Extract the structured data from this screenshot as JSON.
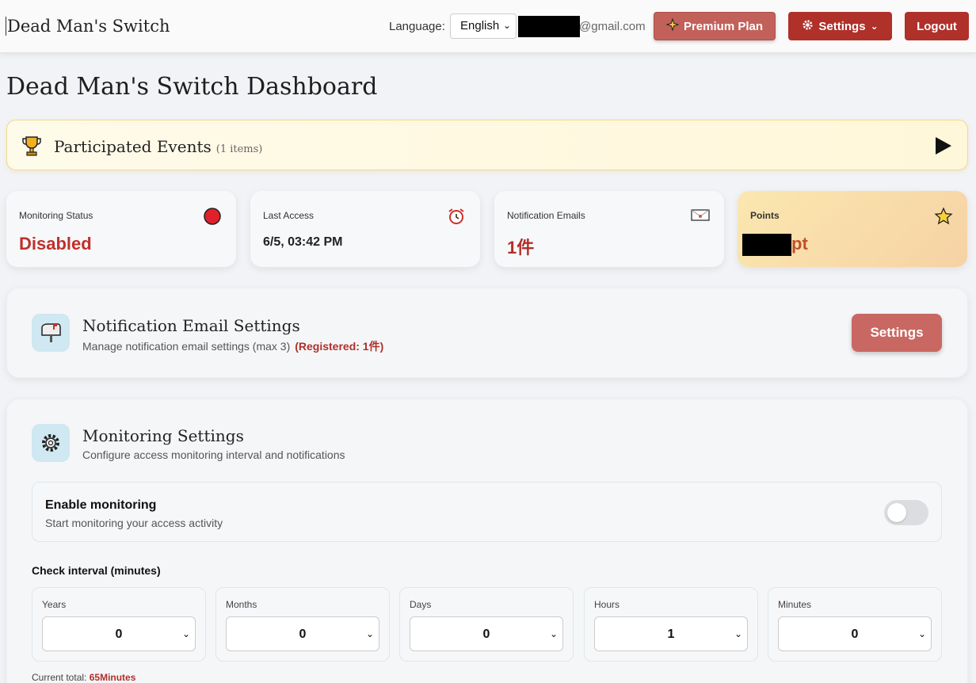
{
  "header": {
    "brand": "Dead Man's Switch",
    "language_label": "Language:",
    "language_value": "English",
    "email_suffix": "@gmail.com",
    "premium_label": "Premium Plan",
    "settings_label": "Settings",
    "logout_label": "Logout"
  },
  "page_title": "Dead Man's Switch Dashboard",
  "events": {
    "title": "Participated Events",
    "count": "(1 items)"
  },
  "stats": {
    "monitoring": {
      "label": "Monitoring Status",
      "value": "Disabled",
      "color": "#c0302a"
    },
    "last_access": {
      "label": "Last Access",
      "value": "6/5, 03:42 PM"
    },
    "emails": {
      "label": "Notification Emails",
      "value": "1件",
      "color": "#b0302a"
    },
    "points": {
      "label": "Points",
      "suffix": "pt",
      "color": "#c0502a"
    }
  },
  "notification_panel": {
    "title": "Notification Email Settings",
    "subtitle": "Manage notification email settings (max 3)",
    "registered": "(Registered: 1件)",
    "button_label": "Settings"
  },
  "monitoring_panel": {
    "title": "Monitoring Settings",
    "subtitle": "Configure access monitoring interval and notifications",
    "enable_title": "Enable monitoring",
    "enable_sub": "Start monitoring your access activity",
    "enabled": false,
    "interval_label": "Check interval (minutes)",
    "fields": [
      {
        "label": "Years",
        "value": "0"
      },
      {
        "label": "Months",
        "value": "0"
      },
      {
        "label": "Days",
        "value": "0"
      },
      {
        "label": "Hours",
        "value": "1"
      },
      {
        "label": "Minutes",
        "value": "0"
      }
    ],
    "total_label": "Current total:",
    "total_value": "65Minutes"
  },
  "colors": {
    "primary": "#b0302a",
    "premium": "#c2605a",
    "accent_bg": "#cfe8f1"
  }
}
